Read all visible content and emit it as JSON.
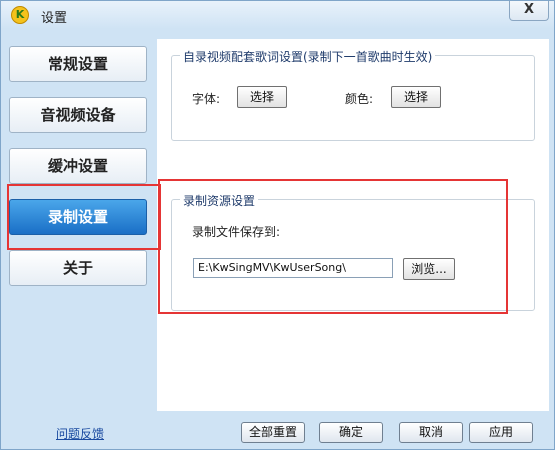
{
  "window": {
    "title": "设置",
    "close_label": "X",
    "app_icon_glyph": "K"
  },
  "sidebar": {
    "items": [
      {
        "label": "常规设置"
      },
      {
        "label": "音视频设备"
      },
      {
        "label": "缓冲设置"
      },
      {
        "label": "录制设置"
      },
      {
        "label": "关于"
      }
    ],
    "active_index": 3
  },
  "lyrics_group": {
    "title": "自录视频配套歌词设置(录制下一首歌曲时生效)",
    "font_label": "字体:",
    "font_button": "选择",
    "color_label": "颜色:",
    "color_button": "选择"
  },
  "record_group": {
    "title": "录制资源设置",
    "save_label": "录制文件保存到:",
    "save_path": "E:\\KwSingMV\\KwUserSong\\",
    "browse_button": "浏览..."
  },
  "footer": {
    "feedback_link": "问题反馈",
    "reset_all": "全部重置",
    "ok": "确定",
    "cancel": "取消",
    "apply": "应用"
  },
  "colors": {
    "accent": "#1a6fc6",
    "highlight_box": "#e53535",
    "background": "#cfe3f4"
  }
}
